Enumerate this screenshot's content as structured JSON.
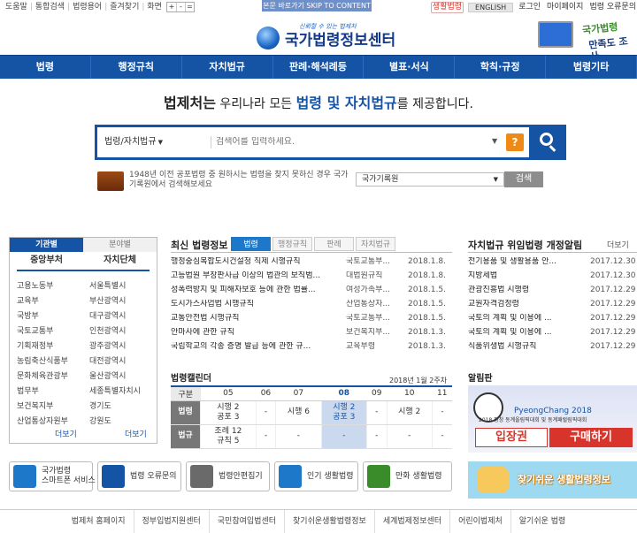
{
  "util": {
    "links": [
      "도움말",
      "통합검색",
      "법령용어",
      "즐겨찾기"
    ],
    "zoom_label": "화면",
    "zoom_buttons": [
      "+",
      "-",
      "="
    ],
    "skip_link": "본문 바로가기 SKIP TO CONTENT",
    "right_links": [
      "생활법령",
      "ENGLISH",
      "로그인",
      "마이페이지",
      "법령 오류문의"
    ]
  },
  "logo": {
    "slogan": "신뢰할 수 있는 법제처",
    "name": "국가법령정보센터"
  },
  "survey": {
    "line1": "국가법령",
    "line2": "만족도 조사"
  },
  "nav": [
    "법령",
    "행정규칙",
    "자치법규",
    "판례·해석례등",
    "별표·서식",
    "학칙·규정",
    "법령기타"
  ],
  "headline": {
    "prefix": "법제처는",
    "mid": " 우리나라 모든 ",
    "highlight": "법령 및 자치법규",
    "suffix": "를 제공합니다."
  },
  "search": {
    "scope": "법령/자치법규",
    "placeholder": "검색어를 입력하세요.",
    "help": "?"
  },
  "archive": {
    "text": "1948년 이전 공포법령 중 원하시는 법령을 찾지 못하신 경우 국가기록원에서 검색해보세요",
    "select": "국가기록원",
    "button": "검색"
  },
  "left": {
    "tabs": [
      "기관별",
      "분야별"
    ],
    "col_heads": [
      "중앙부처",
      "자치단체"
    ],
    "central": [
      "고용노동부",
      "교육부",
      "국방부",
      "국토교통부",
      "기획재정부",
      "농림축산식품부",
      "문화체육관광부",
      "법무부",
      "보건복지부",
      "산업통상자원부"
    ],
    "local": [
      "서울특별시",
      "부산광역시",
      "대구광역시",
      "인천광역시",
      "광주광역시",
      "대전광역시",
      "울산광역시",
      "세종특별자치시",
      "경기도",
      "강원도"
    ],
    "more": "더보기"
  },
  "latest": {
    "title": "최신 법령정보",
    "tabs": [
      "법령",
      "행정규칙",
      "판례",
      "자치법규"
    ],
    "rows": [
      {
        "title": "행정중심복합도시건설청 직제 시행규칙",
        "ministry": "국토교통부...",
        "date": "2018.1.8."
      },
      {
        "title": "고등법원 부장판사급 이상의 법관의 보직범...",
        "ministry": "대법원규칙",
        "date": "2018.1.8."
      },
      {
        "title": "성폭력방지 및 피해자보호 등에 관한 법률...",
        "ministry": "여성가족부...",
        "date": "2018.1.5."
      },
      {
        "title": "도시가스사업법 시행규칙",
        "ministry": "산업통상자...",
        "date": "2018.1.5."
      },
      {
        "title": "교통안전법 시행규칙",
        "ministry": "국토교통부...",
        "date": "2018.1.5."
      },
      {
        "title": "안마사에 관한 규칙",
        "ministry": "보건복지부...",
        "date": "2018.1.3."
      },
      {
        "title": "국립학교의 각종 증명 발급 등에 관한 규...",
        "ministry": "교육부령",
        "date": "2018.1.3."
      }
    ]
  },
  "calendar": {
    "title": "법령캘린더",
    "date": "2018년 1월 2주차",
    "head": [
      "구분",
      "05",
      "06",
      "07",
      "08",
      "09",
      "10",
      "11"
    ],
    "law_label": "법령",
    "law": [
      "시행 2\n공포 3",
      "-",
      "시행 6",
      "시행 2\n공포 3",
      "-",
      "시행 2",
      "-"
    ],
    "rule_label": "법규",
    "rule": [
      "조례 12\n규칙 5",
      "-",
      "-",
      "-",
      "-",
      "-",
      "-"
    ]
  },
  "local_revisions": {
    "title": "자치법규 위임법령 개정알림",
    "more": "더보기",
    "rows": [
      {
        "title": "전기용품 및 생활용품 안...",
        "date": "2017.12.30"
      },
      {
        "title": "지방세법",
        "date": "2017.12.30"
      },
      {
        "title": "관광진흥법 시행령",
        "date": "2017.12.29"
      },
      {
        "title": "교원자격검정령",
        "date": "2017.12.29"
      },
      {
        "title": "국토의 계획 및 이용에 ...",
        "date": "2017.12.29"
      },
      {
        "title": "국토의 계획 및 이용에 ...",
        "date": "2017.12.29"
      },
      {
        "title": "식품위생법 시행규칙",
        "date": "2017.12.29"
      }
    ]
  },
  "notice": {
    "title": "알림판",
    "banner_brand": "PyeongChang 2018",
    "banner_sub": "2018 평창 동계올림픽대회 및 동계패럴림픽대회",
    "ticket": "입장권",
    "buy": "구매하기",
    "banner2": "찾기쉬운 생활법령정보"
  },
  "quick": [
    {
      "label": "국가법령\n스마트폰 서비스",
      "icon": "phone-icon",
      "color": "#1e78c9"
    },
    {
      "label": "법령 오류문의",
      "icon": "law-error-icon",
      "color": "#1553a5"
    },
    {
      "label": "법령안편집기",
      "icon": "editor-icon",
      "color": "#6a6a6a"
    },
    {
      "label": "인기 생활법령",
      "icon": "thumbs-up-icon",
      "color": "#1e78c9"
    },
    {
      "label": "만화 생활법령",
      "icon": "comic-icon",
      "color": "#3a8c2a"
    }
  ],
  "footer": [
    "법제처 홈페이지",
    "정부입법지원센터",
    "국민참여입법센터",
    "찾기쉬운생활법령정보",
    "세계법제정보센터",
    "어린이법제처",
    "알기쉬운 법령"
  ],
  "colors": {
    "brand": "#1553a5",
    "accent": "#f08a16",
    "alert": "#d8342b"
  }
}
